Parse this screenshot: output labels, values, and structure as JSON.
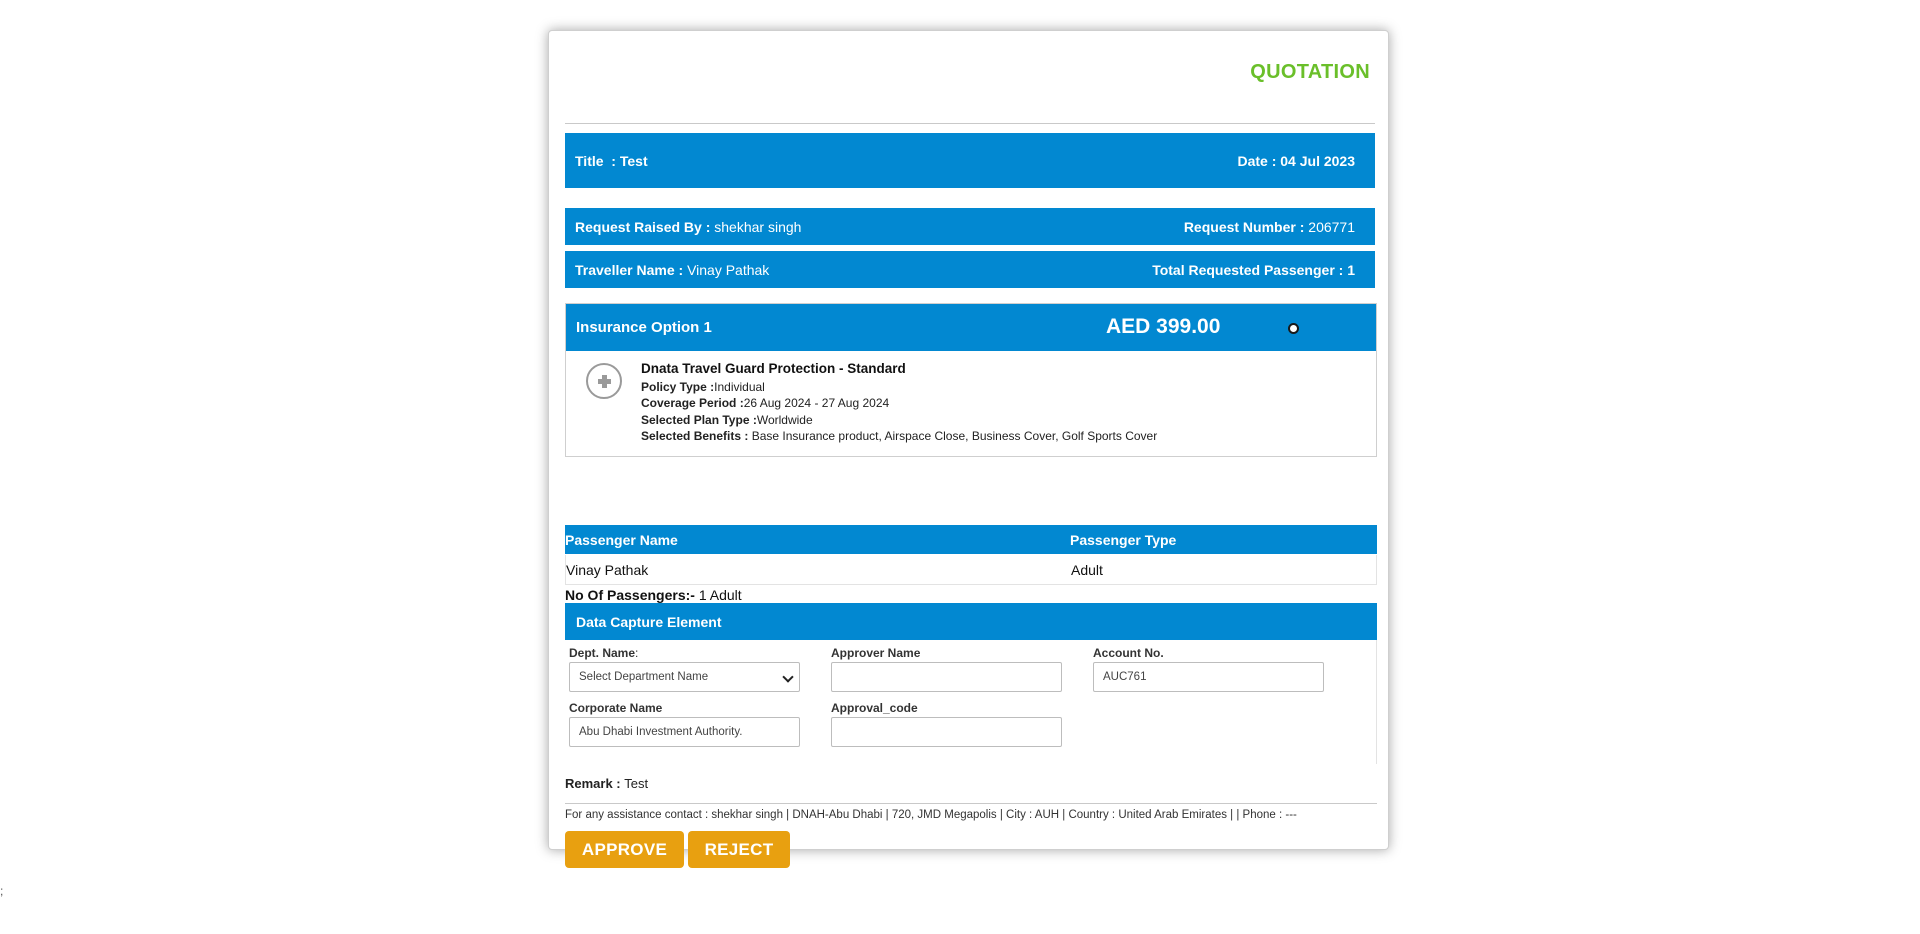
{
  "header": {
    "heading": "QUOTATION"
  },
  "title_bar": {
    "title_text": "Title  : Test",
    "date_text": "Date : 04 Jul 2023"
  },
  "request_bar": {
    "raised_by_label": "Request Raised By : ",
    "raised_by_value": "shekhar singh",
    "number_label": "Request Number : ",
    "number_value": "206771"
  },
  "traveller_bar": {
    "name_label": "Traveller Name : ",
    "name_value": "Vinay Pathak",
    "total_label": "Total Requested Passenger : 1"
  },
  "insurance": {
    "option_label": "Insurance Option 1",
    "price": "AED 399.00",
    "product_name": "Dnata Travel Guard Protection - Standard",
    "policy_type_label": "Policy Type :",
    "policy_type_value": "Individual",
    "coverage_label": "Coverage Period :",
    "coverage_value": "26 Aug 2024 - 27 Aug 2024",
    "plan_type_label": "Selected Plan Type :",
    "plan_type_value": "Worldwide",
    "benefits_label": "Selected Benefits : ",
    "benefits_value": "Base Insurance product, Airspace Close, Business Cover, Golf Sports Cover"
  },
  "passengers": {
    "columns": [
      "Passenger Name",
      "Passenger Type"
    ],
    "rows": [
      {
        "name": "Vinay Pathak",
        "type": "Adult"
      }
    ],
    "count_label": "No Of Passengers:- ",
    "count_value": "1 Adult"
  },
  "data_capture": {
    "heading": "Data Capture Element",
    "dept_label": "Dept. Name",
    "dept_colon": ":",
    "dept_selected": "Select Department Name",
    "approver_label": "Approver Name",
    "approver_value": "",
    "account_label": "Account No.",
    "account_value": "AUC761",
    "corporate_label": "Corporate Name",
    "corporate_value": "Abu Dhabi Investment Authority.",
    "approval_code_label": "Approval_code",
    "approval_code_value": ""
  },
  "remark": {
    "label": "Remark : ",
    "value": "Test"
  },
  "assistance": {
    "text": "For any assistance contact : shekhar singh | DNAH-Abu Dhabi | 720, JMD Megapolis | City : AUH | Country : United Arab Emirates | | Phone : ---"
  },
  "actions": {
    "approve_label": "APPROVE",
    "reject_label": "REJECT"
  },
  "stray_text": ";",
  "colors": {
    "brand_blue": "#0288d1",
    "quotation_green": "#6abf2a",
    "button_orange": "#e8a010"
  }
}
